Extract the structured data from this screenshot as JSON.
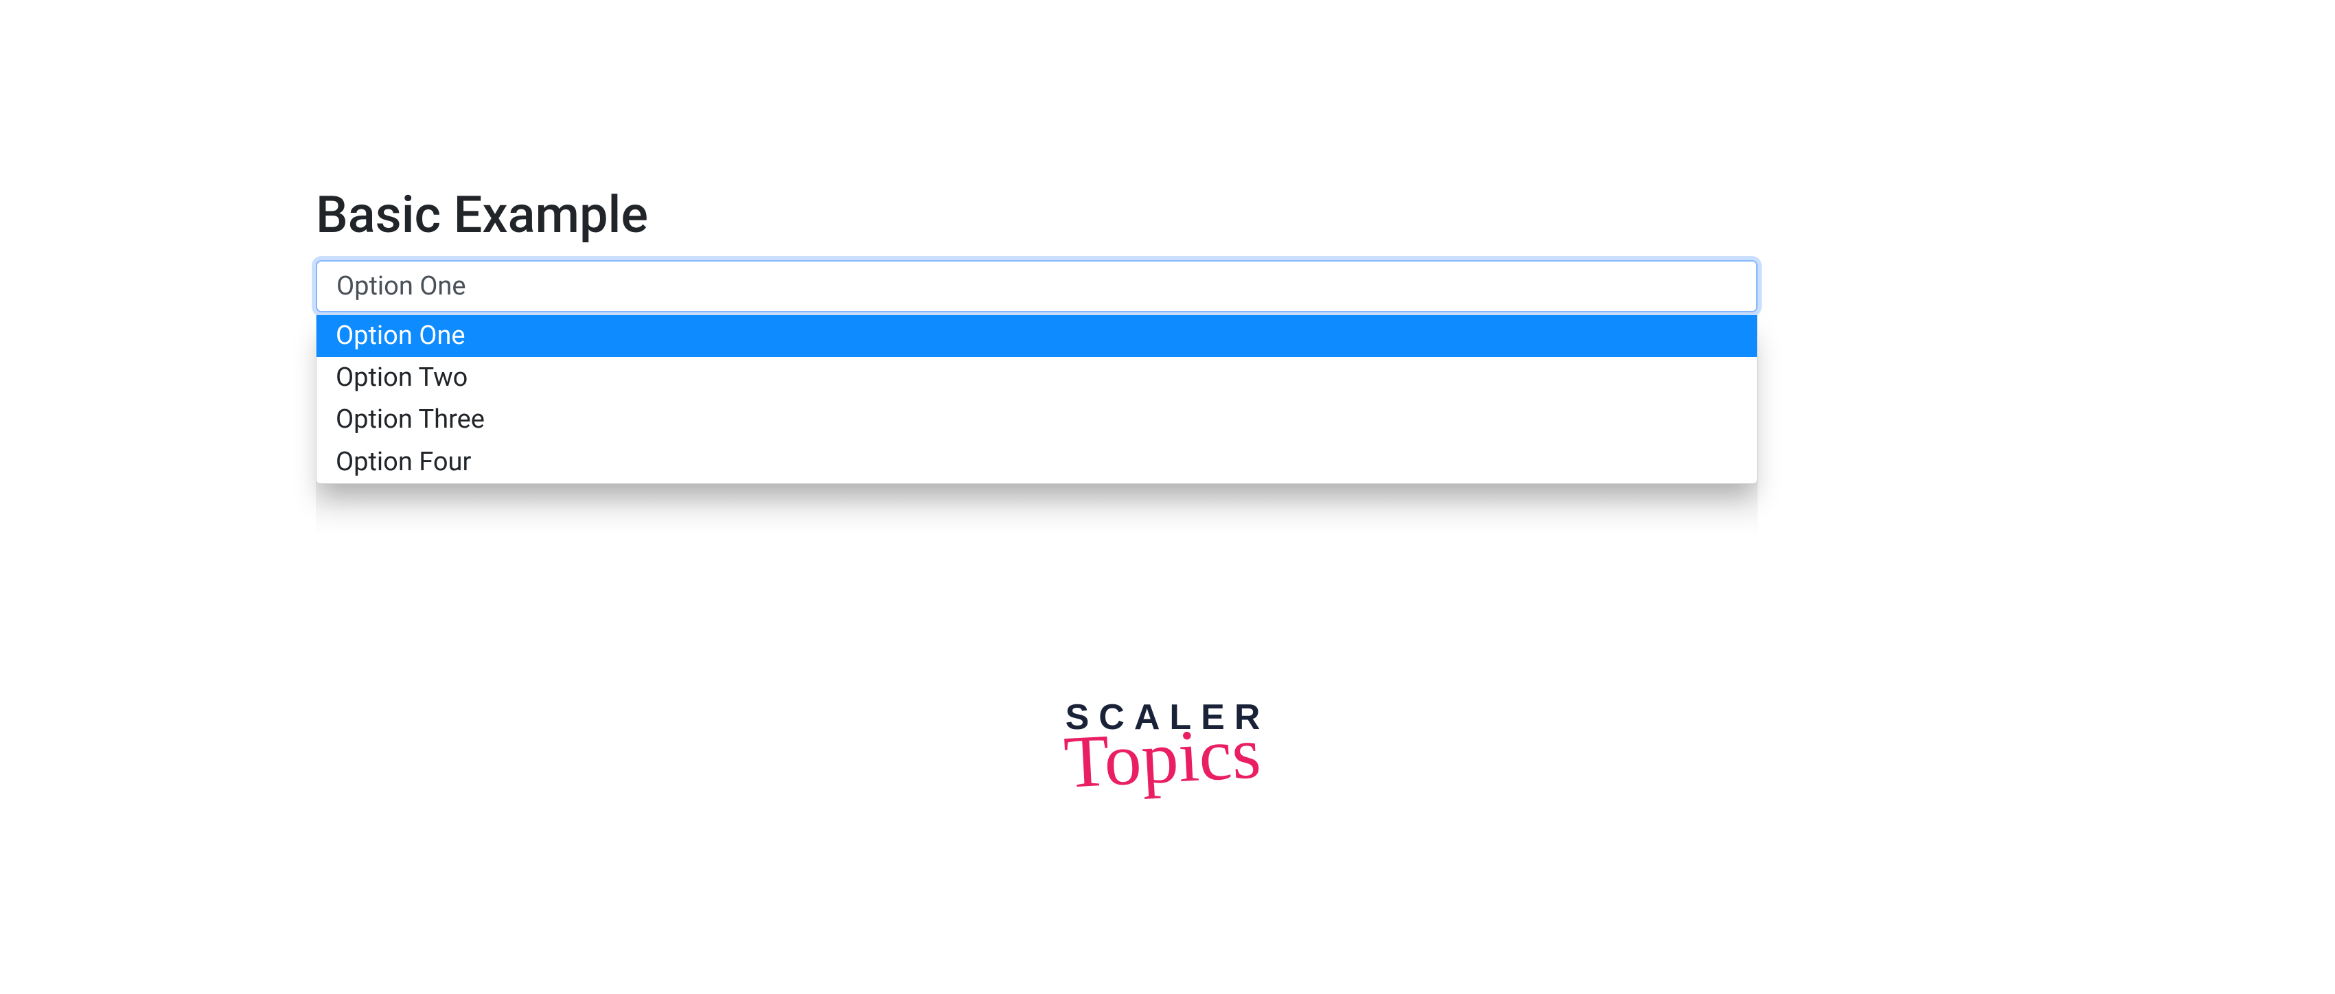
{
  "heading": "Basic Example",
  "select": {
    "selected_label": "Option One",
    "options": [
      {
        "label": "Option One",
        "highlighted": true
      },
      {
        "label": "Option Two",
        "highlighted": false
      },
      {
        "label": "Option Three",
        "highlighted": false
      },
      {
        "label": "Option Four",
        "highlighted": false
      }
    ]
  },
  "brand": {
    "line1": "SCALER",
    "line2": "Topics"
  },
  "colors": {
    "highlight": "#0d8bff",
    "focus_ring": "#86b7fe",
    "brand_dark": "#1a2238",
    "brand_pink": "#e91e63"
  }
}
